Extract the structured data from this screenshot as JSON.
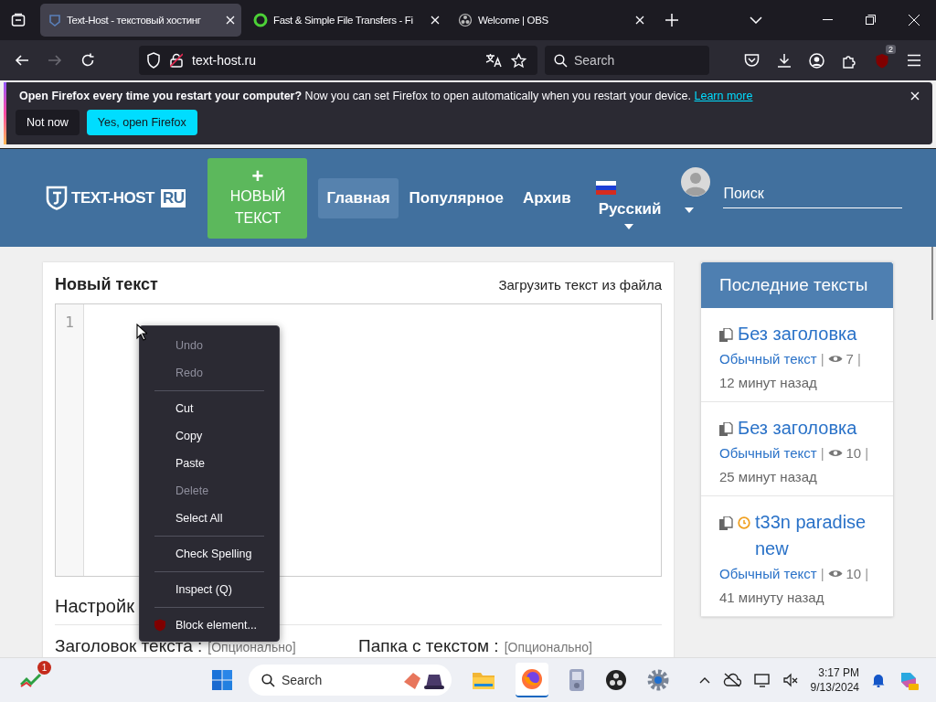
{
  "browser": {
    "tabs": [
      {
        "title": "Text-Host - текстовый хостинг",
        "selected": true
      },
      {
        "title": "Fast & Simple File Transfers - Fi",
        "selected": false
      },
      {
        "title": "Welcome | OBS",
        "selected": false
      }
    ],
    "url": "text-host.ru",
    "search_placeholder": "Search",
    "extension_badge": "2"
  },
  "notification": {
    "bold": "Open Firefox every time you restart your computer?",
    "text": "Now you can set Firefox to open automatically when you restart your device.",
    "link": "Learn more",
    "buttons": [
      {
        "label": "Not now",
        "kind": "secondary"
      },
      {
        "label": "Yes, open Firefox",
        "kind": "primary"
      }
    ]
  },
  "site": {
    "logo": "TEXT-HOST",
    "logo_badge": "RU",
    "new_button": {
      "icon": "+",
      "label": "НОВЫЙ ТЕКСТ"
    },
    "nav": [
      {
        "label": "Главная",
        "selected": true
      },
      {
        "label": "Популярное",
        "selected": false
      },
      {
        "label": "Архив",
        "selected": false
      }
    ],
    "language": "Русский",
    "search_placeholder": "Поиск"
  },
  "editor": {
    "title": "Новый текст",
    "upload_link": "Загрузить текст из файла",
    "line_numbers": [
      "1"
    ]
  },
  "settings": {
    "heading": "Настройк",
    "fields": [
      {
        "label": "Заголовок текста :",
        "hint": "[Опционально]"
      },
      {
        "label": "Папка с текстом :",
        "hint": "[Опционально]"
      }
    ]
  },
  "sidebar": {
    "title": "Последние тексты",
    "items": [
      {
        "title": "Без заголовка",
        "timer": false,
        "type": "Обычный текст",
        "sep_before": "|",
        "views": "7",
        "sep_after": "|",
        "time": "12 минут назад"
      },
      {
        "title": "Без заголовка",
        "timer": false,
        "type": "Обычный текст",
        "sep_before": "|",
        "views": "10",
        "sep_after": "|",
        "time": "25 минут назад"
      },
      {
        "title": "t33n paradise new",
        "timer": true,
        "type": "Обычный текст",
        "sep_before": "|",
        "views": "10",
        "sep_after": "|",
        "time": "41 минуту назад"
      }
    ]
  },
  "context_menu": [
    {
      "kind": "item",
      "label": "Undo",
      "disabled": true
    },
    {
      "kind": "item",
      "label": "Redo",
      "disabled": true
    },
    {
      "kind": "separator"
    },
    {
      "kind": "item",
      "label": "Cut",
      "disabled": false
    },
    {
      "kind": "item",
      "label": "Copy",
      "disabled": false
    },
    {
      "kind": "item",
      "label": "Paste",
      "disabled": false
    },
    {
      "kind": "item",
      "label": "Delete",
      "disabled": true
    },
    {
      "kind": "item",
      "label": "Select All",
      "disabled": false
    },
    {
      "kind": "separator"
    },
    {
      "kind": "item",
      "label": "Check Spelling",
      "disabled": false
    },
    {
      "kind": "separator"
    },
    {
      "kind": "item",
      "label": "Inspect (Q)",
      "disabled": false
    },
    {
      "kind": "separator"
    },
    {
      "kind": "extension",
      "label": "Block element...",
      "disabled": false
    }
  ],
  "taskbar": {
    "widget_badge": "1",
    "search_placeholder": "Search",
    "time": "3:17 PM",
    "date": "9/13/2024"
  }
}
